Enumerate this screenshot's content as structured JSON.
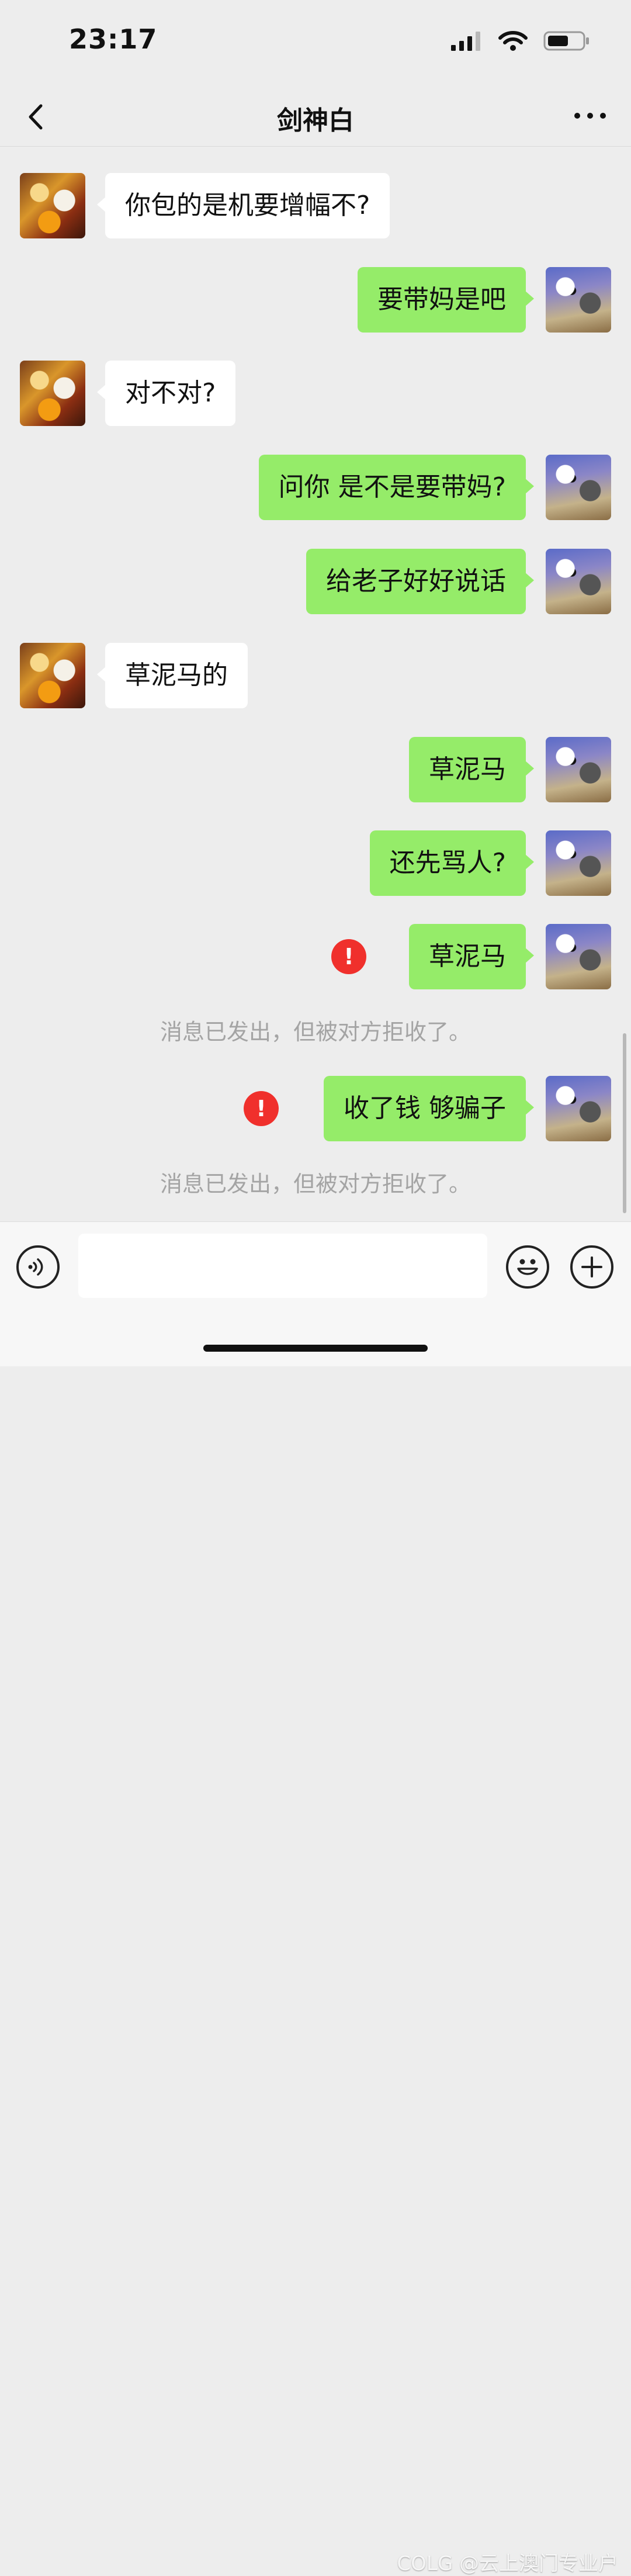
{
  "status_bar": {
    "time": "23:17"
  },
  "header": {
    "title": "剑神白"
  },
  "messages": [
    {
      "sender": "other",
      "text": "你包的是机要增幅不?"
    },
    {
      "sender": "me",
      "text": "要带妈是吧"
    },
    {
      "sender": "other",
      "text": "对不对?"
    },
    {
      "sender": "me",
      "text": "问你 是不是要带妈?"
    },
    {
      "sender": "me",
      "text": "给老子好好说话"
    },
    {
      "sender": "other",
      "text": "草泥马的"
    },
    {
      "sender": "me",
      "text": "草泥马"
    },
    {
      "sender": "me",
      "text": "还先骂人?"
    },
    {
      "sender": "me",
      "text": "草泥马",
      "status": "rejected"
    },
    {
      "type": "system",
      "text": "消息已发出，但被对方拒收了。"
    },
    {
      "sender": "me",
      "text": "收了钱 够骗子",
      "status": "rejected"
    },
    {
      "type": "system",
      "text": "消息已发出，但被对方拒收了。"
    }
  ],
  "failed_icon_text": "!",
  "input": {
    "value": "",
    "placeholder": ""
  },
  "watermark": "COLG @云上澳门专业户",
  "icons": {
    "back": "chevron-left-icon",
    "more": "more-horizontal-icon",
    "voice": "voice-icon",
    "emoji": "emoji-icon",
    "plus": "plus-icon",
    "failed": "error-icon"
  },
  "colors": {
    "background": "#ededed",
    "my_bubble": "#95ec69",
    "other_bubble": "#ffffff",
    "error": "#f0302c"
  }
}
